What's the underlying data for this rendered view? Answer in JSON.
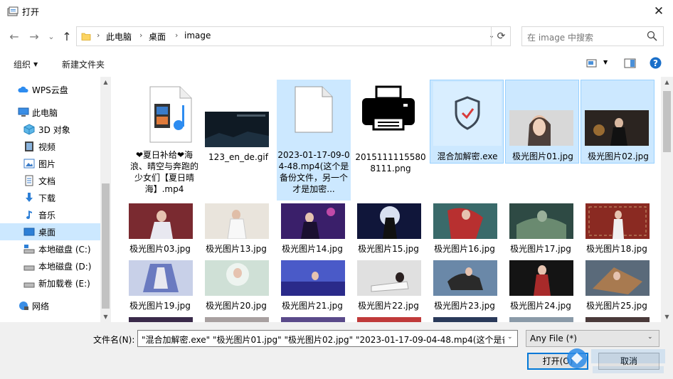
{
  "window": {
    "title": "打开",
    "close_icon": "close-icon"
  },
  "nav": {
    "back": "←",
    "forward": "→",
    "dropdown": "⌄",
    "up": "↑"
  },
  "address": {
    "crumbs": [
      "此电脑",
      "桌面",
      "image"
    ],
    "sep": "›"
  },
  "search": {
    "placeholder": "在 image 中搜索"
  },
  "toolbar": {
    "organize": "组织",
    "new_folder": "新建文件夹"
  },
  "sidebar": {
    "items": [
      {
        "label": "WPS云盘",
        "icon": "cloud-icon"
      },
      {
        "label": "此电脑",
        "icon": "computer-icon"
      },
      {
        "label": "3D 对象",
        "icon": "3d-objects-icon"
      },
      {
        "label": "视频",
        "icon": "video-icon"
      },
      {
        "label": "图片",
        "icon": "pictures-icon"
      },
      {
        "label": "文档",
        "icon": "documents-icon"
      },
      {
        "label": "下载",
        "icon": "download-icon"
      },
      {
        "label": "音乐",
        "icon": "music-icon"
      },
      {
        "label": "桌面",
        "icon": "desktop-icon"
      },
      {
        "label": "本地磁盘 (C:)",
        "icon": "drive-icon"
      },
      {
        "label": "本地磁盘 (D:)",
        "icon": "drive-icon"
      },
      {
        "label": "新加载卷 (E:)",
        "icon": "drive-icon"
      },
      {
        "label": "网络",
        "icon": "network-icon"
      }
    ]
  },
  "files": {
    "row1": [
      {
        "name": "❤夏日补给❤海浪、晴空与奔跑的少女们【夏日晴海】.mp4",
        "icon": "video-file-icon"
      },
      {
        "name": "123_en_de.gif",
        "icon": "gif-thumbnail"
      },
      {
        "name": "2023-01-17-09-04-48.mp4(这个是备份文件，另一个才是加密...",
        "icon": "blank-file-icon"
      },
      {
        "name": "20151111155808111.png",
        "icon": "printer-thumbnail"
      },
      {
        "name": "混合加解密.exe",
        "icon": "shield-app-icon"
      },
      {
        "name": "极光图片01.jpg",
        "icon": "photo-thumbnail"
      },
      {
        "name": "极光图片02.jpg",
        "icon": "photo-thumbnail"
      }
    ],
    "row2": [
      "极光图片03.jpg",
      "极光图片13.jpg",
      "极光图片14.jpg",
      "极光图片15.jpg",
      "极光图片16.jpg",
      "极光图片17.jpg",
      "极光图片18.jpg"
    ],
    "row3": [
      "极光图片19.jpg",
      "极光图片20.jpg",
      "极光图片21.jpg",
      "极光图片22.jpg",
      "极光图片23.jpg",
      "极光图片24.jpg",
      "极光图片25.jpg"
    ]
  },
  "bottom": {
    "filename_label": "文件名(N):",
    "filename_value": "\"混合加解密.exe\" \"极光图片01.jpg\" \"极光图片02.jpg\" \"2023-01-17-09-04-48.mp4(这个是备份",
    "filetype_value": "Any File (*)",
    "open_label": "打开(O)",
    "cancel_label": "取消"
  },
  "colors": {
    "selection": "#cce8ff",
    "accent": "#0078d7"
  }
}
